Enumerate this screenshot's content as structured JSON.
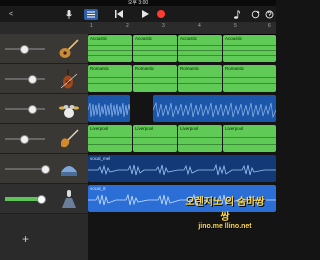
{
  "status": {
    "time": "오후 3:00"
  },
  "toolbar": {
    "back_label": "<",
    "mic_icon": "mic-icon",
    "tracks_icon": "tracks-view-icon",
    "play_icon": "play-icon",
    "stop_icon": "stop-icon",
    "record_icon": "record-icon",
    "metronome_icon": "metronome-icon",
    "loop_icon": "loop-icon",
    "settings_icon": "settings-icon"
  },
  "ruler": {
    "bars": [
      "1",
      "2",
      "3",
      "4",
      "5",
      "6"
    ]
  },
  "tracks": [
    {
      "instrument": "acoustic-guitar",
      "volume": 0.55,
      "region_label": "Acoustic",
      "color": "#5fca55"
    },
    {
      "instrument": "violin",
      "volume": 0.7,
      "region_label": "Romantic",
      "color": "#5fca55"
    },
    {
      "instrument": "drum-kit",
      "volume": 0.7,
      "region_label": "",
      "color": "#1c56a8"
    },
    {
      "instrument": "electric-guitar",
      "volume": 0.55,
      "region_label": "Liverpool",
      "color": "#5fca55"
    },
    {
      "instrument": "audio-recorder",
      "volume": 0.95,
      "region_label": "vocal_mel",
      "color": "#133a76"
    },
    {
      "instrument": "audio-recorder-selected",
      "volume": 0.85,
      "region_label": "vocal_8",
      "color": "#133a76"
    }
  ],
  "add_track_label": "+",
  "watermark": {
    "line1": "오렌지노 의 숨바쌍쌍",
    "line2": "jino.me   llino.net"
  }
}
